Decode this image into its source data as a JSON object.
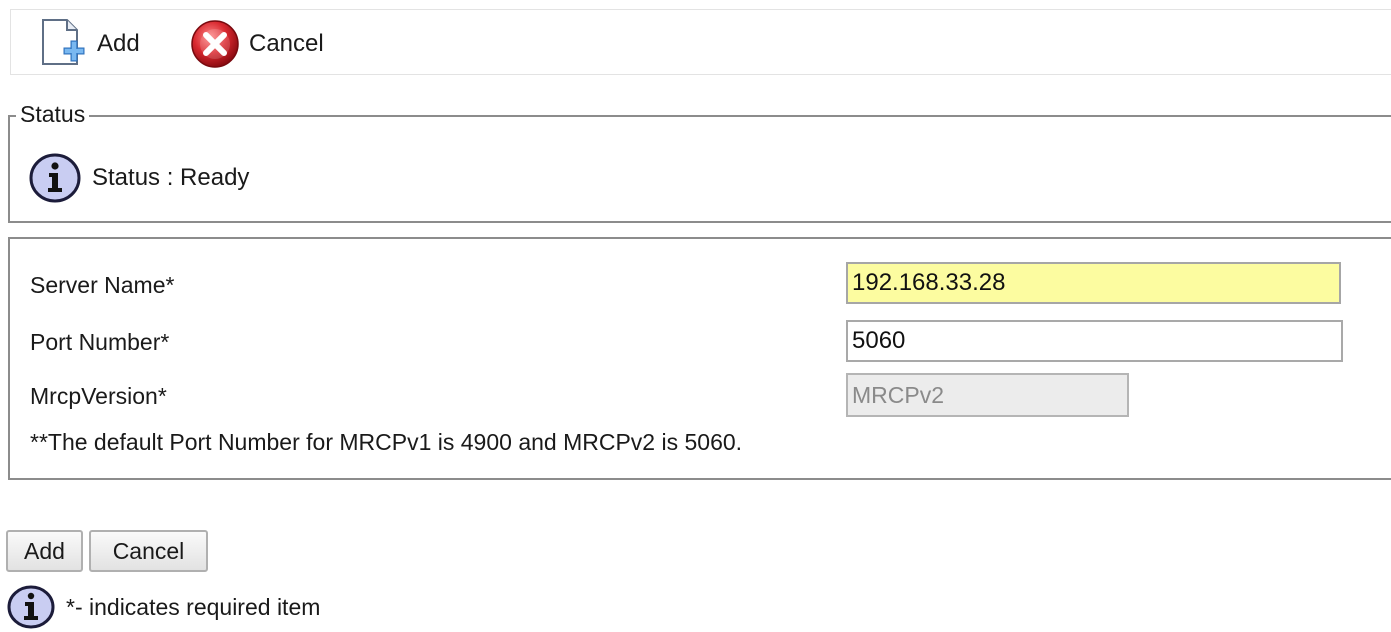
{
  "toolbar": {
    "add_label": "Add",
    "cancel_label": "Cancel",
    "add_icon": "add-document-icon",
    "cancel_icon": "cancel-icon"
  },
  "status": {
    "legend": "Status",
    "text": "Status : Ready",
    "icon": "info-icon"
  },
  "form": {
    "server_name": {
      "label": "Server Name*",
      "value": "192.168.33.28",
      "highlight_color": "#fcfca0"
    },
    "port_number": {
      "label": "Port Number*",
      "value": "5060"
    },
    "mrcp_version": {
      "label": "MrcpVersion*",
      "value": "MRCPv2",
      "disabled": true
    },
    "note": "**The default Port Number for MRCPv1 is 4900 and MRCPv2 is 5060."
  },
  "buttons": {
    "add_label": "Add",
    "cancel_label": "Cancel"
  },
  "footer": {
    "required_note": "*- indicates required item",
    "icon": "info-icon"
  },
  "colors": {
    "border": "#8c8c8c",
    "info_icon_fill": "#c9cdf2",
    "cancel_icon_red": "#d8282f"
  }
}
